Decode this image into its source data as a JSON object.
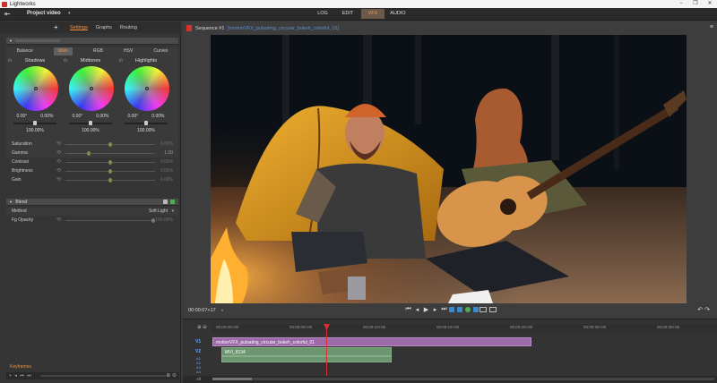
{
  "app": {
    "title": "Lightworks",
    "window_controls": [
      "−",
      "❐",
      "✕"
    ]
  },
  "topbar": {
    "project_name": "Project video",
    "tabs": [
      {
        "label": "LOG",
        "active": false
      },
      {
        "label": "EDIT",
        "active": false
      },
      {
        "label": "VFX",
        "active": true
      },
      {
        "label": "AUDIO",
        "active": false
      }
    ]
  },
  "left_panel": {
    "tabs": [
      {
        "label": "Settings",
        "active": true
      },
      {
        "label": "Graphs",
        "active": false
      },
      {
        "label": "Routing",
        "active": false
      }
    ],
    "cc_section": {
      "tabs": [
        {
          "label": "Balance",
          "active": false
        },
        {
          "label": "Main",
          "active": true
        },
        {
          "label": "RGB",
          "active": false
        },
        {
          "label": "HSV",
          "active": false
        },
        {
          "label": "Curves",
          "active": false
        }
      ],
      "wheels": [
        {
          "label": "Shadows",
          "v1": "0.00°",
          "v2": "0.00%",
          "pct": "100.00%"
        },
        {
          "label": "Midtones",
          "v1": "0.00°",
          "v2": "0.00%",
          "pct": "100.00%"
        },
        {
          "label": "Highlights",
          "v1": "0.00°",
          "v2": "0.00%",
          "pct": "100.00%"
        }
      ],
      "params": [
        {
          "label": "Saturation",
          "value": "0.00%",
          "level": 0.5,
          "active": false
        },
        {
          "label": "Gamma",
          "value": "1.00",
          "level": 0.25,
          "active": true
        },
        {
          "label": "Contrast",
          "value": "0.00%",
          "level": 0.5,
          "active": false
        },
        {
          "label": "Brightness",
          "value": "0.00%",
          "level": 0.5,
          "active": false
        },
        {
          "label": "Gain",
          "value": "0.00%",
          "level": 0.5,
          "active": false
        }
      ]
    },
    "blend_section": {
      "title": "Blend",
      "method_label": "Method",
      "method_value": "Soft Light",
      "opacity_label": "Fg Opacity",
      "opacity_value": "100.00%"
    },
    "keyframes_label": "Keyframes"
  },
  "viewer": {
    "sequence": "Sequence #1",
    "clip_name": "[motionVFX_pulsating_circular_bokeh_colorful_01]",
    "timecode": "00:00:07+17",
    "transport": [
      "⏮",
      "◂",
      "▶",
      "▸",
      "⏭"
    ],
    "undo_redo": [
      "↶",
      "↷"
    ]
  },
  "timeline": {
    "ticks": [
      "00:00:00+00",
      "00:00:05+00",
      "00:00:10+00",
      "00:00:15+00",
      "00:00:20+00",
      "00:00:25+00",
      "00:00:30+00"
    ],
    "tracks": [
      {
        "name": "V1",
        "clip": "motionVFX_pulsating_circular_bokeh_colorful_01"
      },
      {
        "name": "V2",
        "clip": "MVI_8134"
      }
    ],
    "audio_tracks": [
      "A1",
      "A2",
      "A3",
      "A4"
    ],
    "all_label": "All"
  },
  "colors": {
    "accent": "#f09040",
    "vfx_tab_bg": "#6b5a4a",
    "fx_clip": "#9c6aa8",
    "video_clip": "#6c9670",
    "playhead": "#d83030",
    "track_label": "#6fa3ff"
  },
  "icons": [
    "exit-icon",
    "plus-icon",
    "record-icon",
    "menu-icon",
    "play-icon",
    "reset-icon",
    "zoom-icon"
  ]
}
